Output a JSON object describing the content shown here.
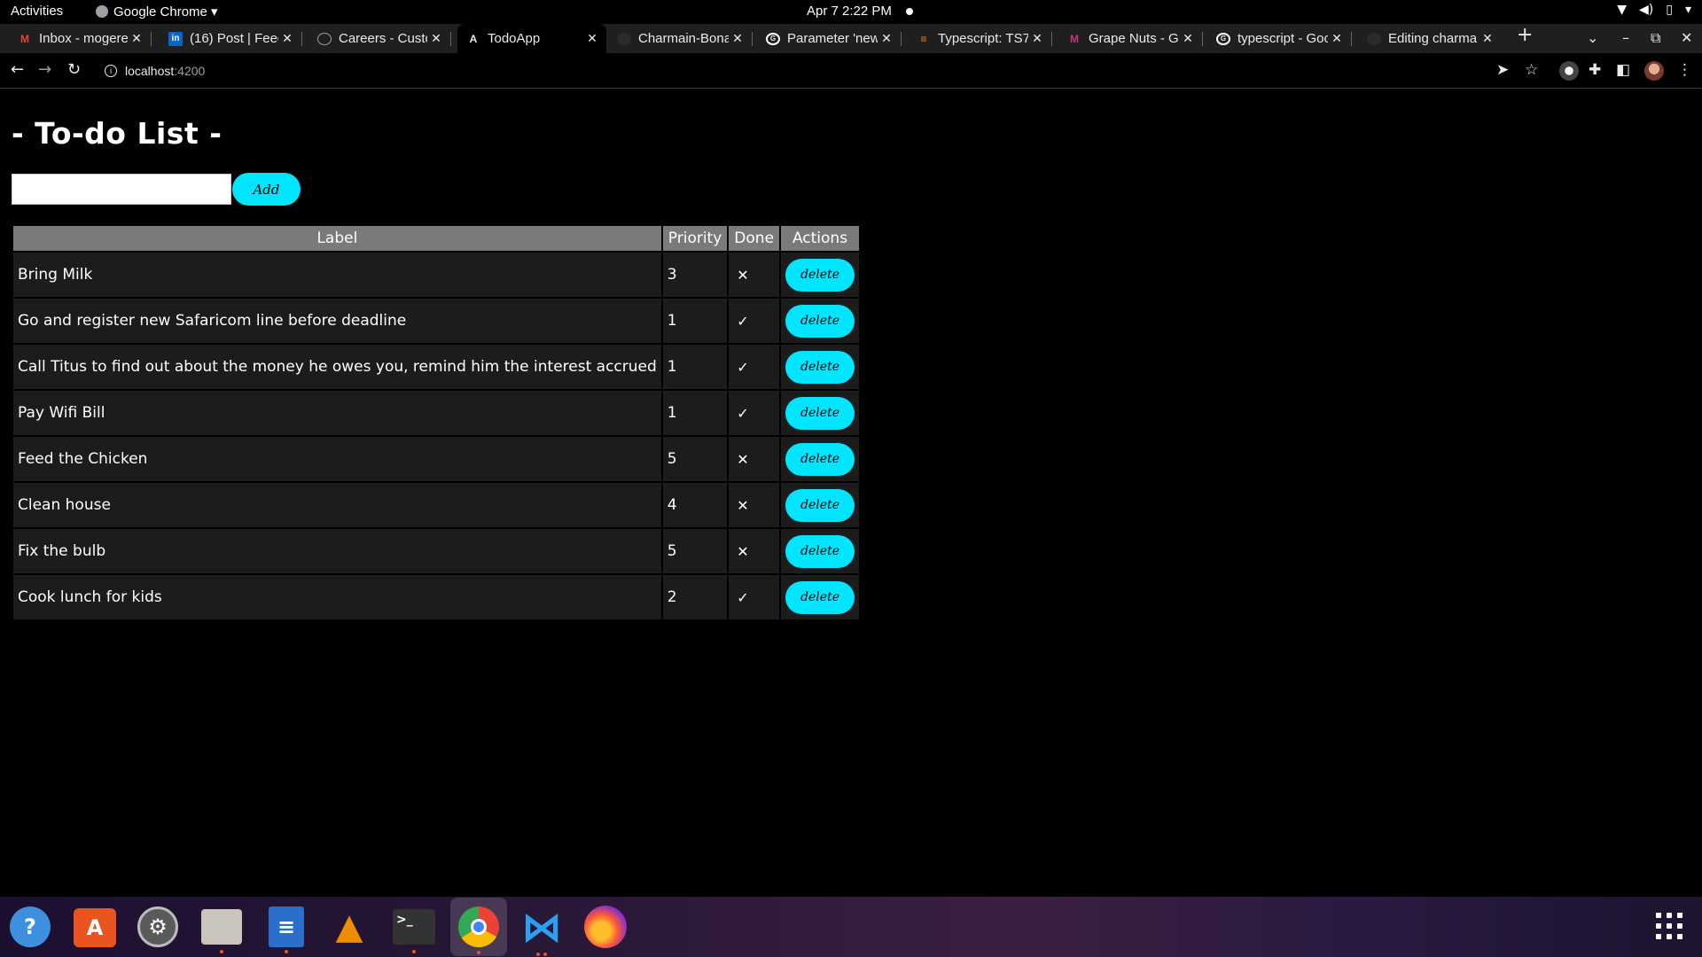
{
  "system_bar": {
    "activities": "Activities",
    "app_menu": "Google Chrome ▾",
    "clock": "Apr 7  2:22 PM"
  },
  "browser": {
    "tabs": [
      {
        "title": "Inbox - mogere",
        "icon": "gmail-icon"
      },
      {
        "title": "(16) Post | Feed",
        "icon": "linkedin-icon"
      },
      {
        "title": "Careers - Custo",
        "icon": "globe-icon"
      },
      {
        "title": "TodoApp",
        "icon": "angular-icon"
      },
      {
        "title": "Charmain-Bona",
        "icon": "github-icon"
      },
      {
        "title": "Parameter 'new",
        "icon": "google-icon"
      },
      {
        "title": "Typescript: TS7",
        "icon": "stackoverflow-icon"
      },
      {
        "title": "Grape Nuts - Go",
        "icon": "dictionary-icon"
      },
      {
        "title": "typescript - Goo",
        "icon": "google-icon"
      },
      {
        "title": "Editing charma",
        "icon": "github-icon"
      }
    ],
    "active_tab_index": 3,
    "new_tab": "+",
    "address": {
      "host": "localhost",
      "port": ":4200"
    }
  },
  "app": {
    "title": "- To-do List -",
    "input_value": "",
    "add_label": "Add",
    "table": {
      "headers": [
        "Label",
        "Priority",
        "Done",
        "Actions"
      ],
      "rows": [
        {
          "label": "Bring Milk",
          "priority": "3",
          "done": "✕"
        },
        {
          "label": "Go and register new Safaricom line before deadline",
          "priority": "1",
          "done": "✓"
        },
        {
          "label": "Call Titus to find out about the money he owes you, remind him the interest accrued",
          "priority": "1",
          "done": "✓"
        },
        {
          "label": "Pay Wifi Bill",
          "priority": "1",
          "done": "✓"
        },
        {
          "label": "Feed the Chicken",
          "priority": "5",
          "done": "✕"
        },
        {
          "label": "Clean house",
          "priority": "4",
          "done": "✕"
        },
        {
          "label": "Fix the bulb",
          "priority": "5",
          "done": "✕"
        },
        {
          "label": "Cook lunch for kids",
          "priority": "2",
          "done": "✓"
        }
      ],
      "delete_label": "delete"
    }
  },
  "dock": {
    "items": [
      "help-icon",
      "app-store-icon",
      "settings-icon",
      "files-icon",
      "text-editor-icon",
      "vlc-icon",
      "terminal-icon",
      "chrome-icon",
      "vscode-icon",
      "firefox-icon"
    ]
  },
  "colors": {
    "accent": "#00e5ff",
    "header_bg": "#7a7a7a",
    "row_bg": "#1c1c1c"
  }
}
